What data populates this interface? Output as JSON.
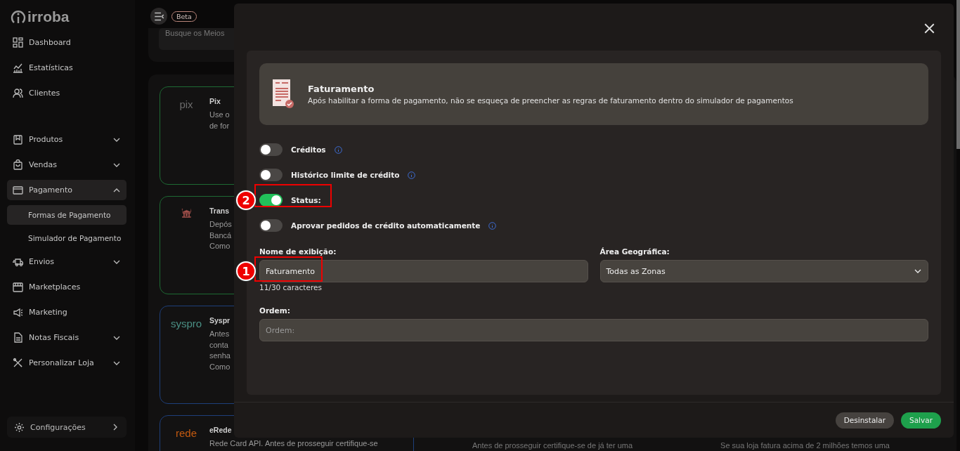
{
  "logo": {
    "text": "irroba"
  },
  "topbar": {
    "badge": "Beta"
  },
  "sidebar": {
    "items": [
      {
        "label": "Dashboard",
        "selected": false
      },
      {
        "label": "Estatísticas",
        "selected": false
      },
      {
        "label": "Clientes",
        "selected": false
      },
      {
        "label": "Produtos",
        "selected": false,
        "expanded": false
      },
      {
        "label": "Vendas",
        "selected": false,
        "expanded": false
      },
      {
        "label": "Pagamento",
        "selected": true,
        "expanded": true,
        "children": [
          {
            "label": "Formas de Pagamento",
            "selected": true
          },
          {
            "label": "Simulador de Pagamento",
            "selected": false
          }
        ]
      },
      {
        "label": "Envios",
        "selected": false,
        "expanded": false
      },
      {
        "label": "Marketplaces",
        "selected": false
      },
      {
        "label": "Marketing",
        "selected": false
      },
      {
        "label": "Notas Fiscais",
        "selected": false,
        "expanded": false
      },
      {
        "label": "Personalizar Loja",
        "selected": false,
        "expanded": false
      }
    ],
    "footer": {
      "label": "Configurações"
    }
  },
  "search": {
    "placeholder": "Busque os Meios"
  },
  "cards": [
    {
      "title": "Pix",
      "logo_text": "pix",
      "lines": [
        "Use o",
        "de for"
      ],
      "color": "#1d6a33"
    },
    {
      "title": "Trans",
      "lines": [
        "Depós",
        "Bancá",
        "Como"
      ],
      "color": "#1d6a33"
    },
    {
      "title": "Syspr",
      "logo_text": "syspro",
      "lines": [
        "Antes",
        "conta",
        "senha",
        "Como"
      ],
      "color": "#1e3f7a"
    },
    {
      "title": "eRede",
      "logo_text": "rede",
      "lines": [
        "Rede Card API. Antes de prosseguir certifique-se"
      ],
      "color": "#1e3f7a"
    }
  ],
  "bottom_texts": [
    "Antes de prosseguir certifique-se de já ter uma",
    "Se sua loja fatura acima de 2 milhões temos uma"
  ],
  "modal": {
    "header": {
      "title": "Faturamento",
      "description": "Após habilitar a forma de pagamento, não se esqueça de preencher as regras de faturamento dentro do simulador de pagamentos"
    },
    "toggles": [
      {
        "label": "Créditos",
        "on": false,
        "info": true
      },
      {
        "label": "Histórico limite de crédito",
        "on": false,
        "info": true
      },
      {
        "label": "Status:",
        "on": true,
        "info": false
      },
      {
        "label": "Aprovar pedidos de crédito automaticamente",
        "on": false,
        "info": true
      }
    ],
    "display_name": {
      "label": "Nome de exibição:",
      "value": "Faturamento",
      "counter": "11/30 caracteres"
    },
    "area": {
      "label": "Área Geográfica:",
      "value": "Todas as Zonas"
    },
    "order": {
      "label": "Ordem:",
      "placeholder": "Ordem:"
    },
    "buttons": [
      {
        "label": "Desinstalar",
        "kind": "secondary"
      },
      {
        "label": "Salvar",
        "kind": "primary"
      }
    ]
  },
  "annotations": [
    {
      "number": "2"
    },
    {
      "number": "1"
    }
  ]
}
